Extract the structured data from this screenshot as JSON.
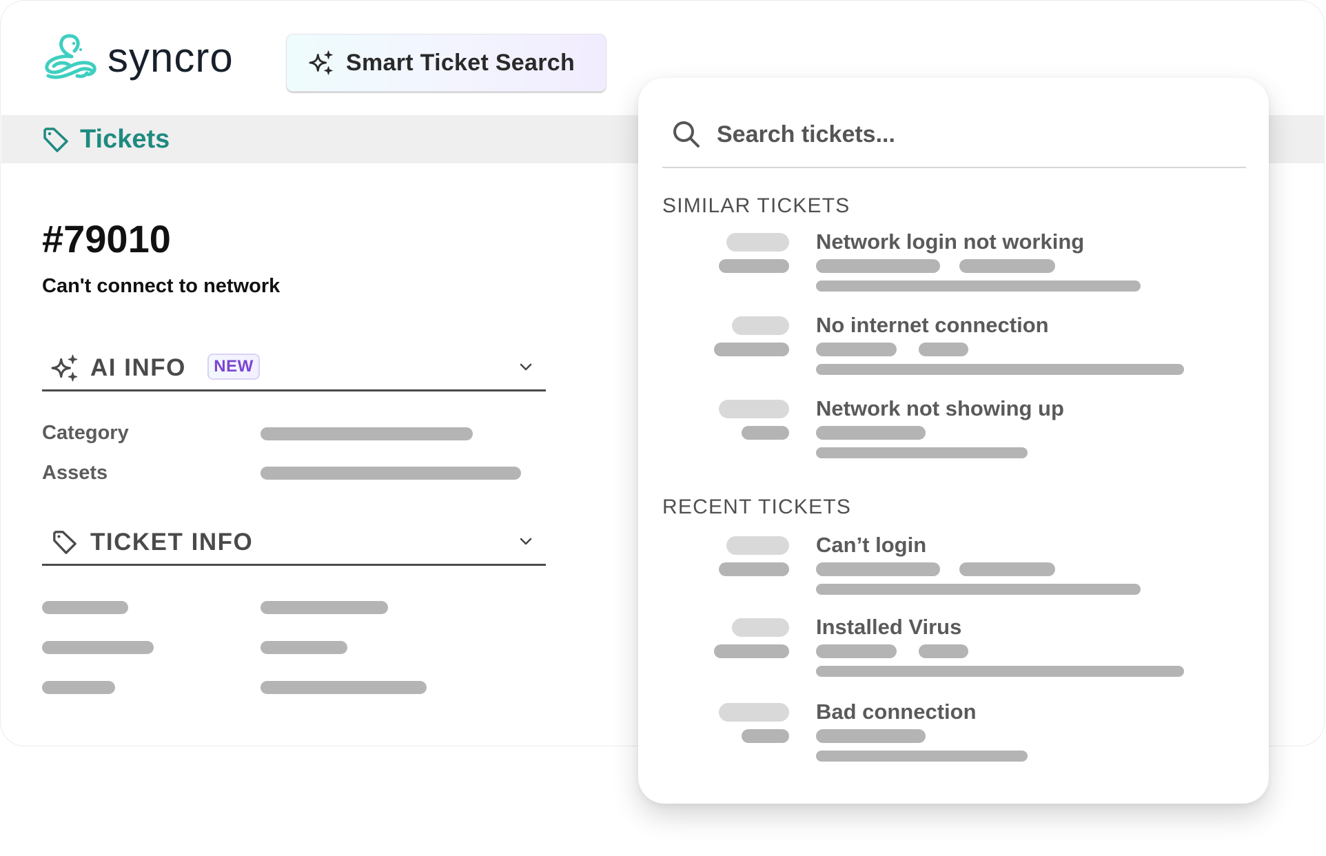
{
  "brand": {
    "name": "syncro",
    "logo_icon": "octopus-logo-icon",
    "accent_color": "#3ecfc0",
    "teal_color": "#1f8a80"
  },
  "header": {
    "smart_search_label": "Smart Ticket Search",
    "smart_search_icon": "sparkle-icon"
  },
  "nav": {
    "tickets_label": "Tickets",
    "tickets_icon": "tag-icon"
  },
  "ticket": {
    "number": "#79010",
    "subject": "Can't connect to network",
    "ai_info": {
      "label": "AI INFO",
      "badge": "NEW",
      "badge_color": "#7b45d0",
      "fields": [
        {
          "label": "Category"
        },
        {
          "label": "Assets"
        }
      ]
    },
    "ticket_info": {
      "label": "TICKET INFO"
    }
  },
  "search_panel": {
    "placeholder": "Search tickets...",
    "groups": [
      {
        "label": "SIMILAR TICKETS",
        "items": [
          {
            "title": "Network login not working"
          },
          {
            "title": "No internet connection"
          },
          {
            "title": "Network not showing up"
          }
        ]
      },
      {
        "label": "RECENT TICKETS",
        "items": [
          {
            "title": "Can’t login"
          },
          {
            "title": "Installed Virus"
          },
          {
            "title": "Bad connection"
          }
        ]
      }
    ]
  }
}
